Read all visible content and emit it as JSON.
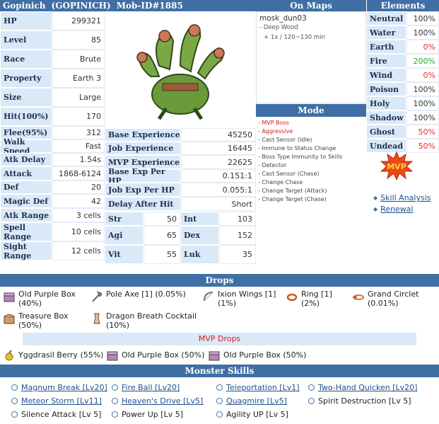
{
  "mob": {
    "name": "Gopinich",
    "sprite": "(GOPINICH)",
    "id_text": "Mob-ID#1885"
  },
  "stats_left": [
    {
      "label": "HP",
      "value": "299321"
    },
    {
      "label": "Level",
      "value": "85"
    },
    {
      "label": "Race",
      "value": "Brute"
    },
    {
      "label": "Property",
      "value": "Earth 3"
    },
    {
      "label": "Size",
      "value": "Large"
    },
    {
      "label": "Hit(100%)",
      "value": "170"
    },
    {
      "label": "Flee(95%)",
      "value": "312"
    },
    {
      "label": "Walk Speed",
      "value": "Fast"
    },
    {
      "label": "Atk Delay",
      "value": "1.54s"
    },
    {
      "label": "Attack",
      "value": "1868-6124"
    },
    {
      "label": "Def",
      "value": "20"
    },
    {
      "label": "Magic Def",
      "value": "42"
    },
    {
      "label": "Atk Range",
      "value": "3 cells"
    },
    {
      "label": "Spell Range",
      "value": "10 cells"
    },
    {
      "label": "Sight Range",
      "value": "12 cells"
    }
  ],
  "exp": [
    {
      "label": "Base Experience",
      "value": "45250"
    },
    {
      "label": "Job Experience",
      "value": "16445"
    },
    {
      "label": "MVP Experience",
      "value": "22625"
    },
    {
      "label": "Base Exp Per HP",
      "value": "0.151:1"
    },
    {
      "label": "Job Exp Per HP",
      "value": "0.055:1"
    },
    {
      "label": "Delay After Hit",
      "value": "Short"
    }
  ],
  "attrs": [
    {
      "label": "Str",
      "value": "50"
    },
    {
      "label": "Int",
      "value": "103"
    },
    {
      "label": "Agi",
      "value": "65"
    },
    {
      "label": "Dex",
      "value": "152"
    },
    {
      "label": "Vit",
      "value": "55"
    },
    {
      "label": "Luk",
      "value": "35"
    }
  ],
  "maps": {
    "header": "On Maps",
    "map": "mosk_dun03",
    "name": "- Deep Wood",
    "spawn": "+ 1x / 120~130 min"
  },
  "mode": {
    "header": "Mode",
    "items": [
      {
        "text": "- MVP Boss",
        "red": true
      },
      {
        "text": "- Aggressive",
        "red": true
      },
      {
        "text": "- Cast Sensor (Idle)",
        "red": false
      },
      {
        "text": "- Immune to Status Change",
        "red": false
      },
      {
        "text": "- Boss Type Immunity to Skills",
        "red": false
      },
      {
        "text": "- Detector",
        "red": false
      },
      {
        "text": "- Cast Sensor (Chase)",
        "red": false
      },
      {
        "text": "- Change Chase",
        "red": false
      },
      {
        "text": "- Change Target (Attack)",
        "red": false
      },
      {
        "text": "- Change Target (Chase)",
        "red": false
      }
    ]
  },
  "elements": {
    "header": "Elements",
    "rows": [
      {
        "label": "Neutral",
        "value": "100%",
        "color": "#333333"
      },
      {
        "label": "Water",
        "value": "100%",
        "color": "#333333"
      },
      {
        "label": "Earth",
        "value": "0%",
        "color": "#e03030"
      },
      {
        "label": "Fire",
        "value": "200%",
        "color": "#2ea02e"
      },
      {
        "label": "Wind",
        "value": "0%",
        "color": "#e03030"
      },
      {
        "label": "Poison",
        "value": "100%",
        "color": "#333333"
      },
      {
        "label": "Holy",
        "value": "100%",
        "color": "#333333"
      },
      {
        "label": "Shadow",
        "value": "100%",
        "color": "#333333"
      },
      {
        "label": "Ghost",
        "value": "50%",
        "color": "#e03030"
      },
      {
        "label": "Undead",
        "value": "50%",
        "color": "#e03030"
      }
    ]
  },
  "mvp_badge": "MVP",
  "links": {
    "skill_analysis": "Skill Analysis",
    "renewal": "Renewal"
  },
  "drops": {
    "header": "Drops",
    "items": [
      {
        "name": "Old Purple Box",
        "chance": "(40%)"
      },
      {
        "name": "Pole Axe [1] (0.05%)",
        "chance": ""
      },
      {
        "name": "Ixion Wings [1]",
        "chance": "(1%)"
      },
      {
        "name": "Ring [1]",
        "chance": "(2%)"
      },
      {
        "name": "Grand Circlet",
        "chance": "(0.01%)"
      },
      {
        "name": "Treasure Box",
        "chance": "(50%)"
      },
      {
        "name": "Dragon Breath Cocktail",
        "chance": "(10%)"
      }
    ],
    "mvp_header": "MVP Drops",
    "mvp_items": [
      {
        "text": "Yggdrasil Berry (55%)"
      },
      {
        "text": "Old Purple Box (50%)"
      },
      {
        "text": "Old Purple Box (50%)"
      }
    ]
  },
  "skills": {
    "header": "Monster Skills",
    "items": [
      {
        "text": "Magnum Break [Lv20]",
        "link": true
      },
      {
        "text": "Fire Ball [Lv20]",
        "link": true
      },
      {
        "text": "Teleportation [Lv1]",
        "link": true
      },
      {
        "text": "Two-Hand Quicken [Lv20]",
        "link": true
      },
      {
        "text": "Meteor Storm [Lv11]",
        "link": true
      },
      {
        "text": "Heaven's Drive [Lv5]",
        "link": true
      },
      {
        "text": "Quagmire [Lv5]",
        "link": true
      },
      {
        "text": "Spirit Destruction [Lv 5]",
        "link": false
      },
      {
        "text": "Silence Attack [Lv 5]",
        "link": false
      },
      {
        "text": "Power Up [Lv 5]",
        "link": false
      },
      {
        "text": "Agility UP [Lv 5]",
        "link": false
      }
    ]
  }
}
